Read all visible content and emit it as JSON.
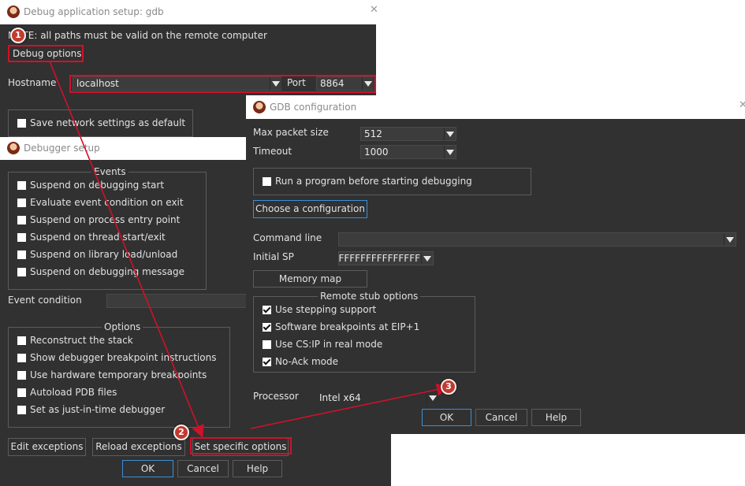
{
  "debug_app_dialog": {
    "title": "Debug application setup: gdb",
    "note": "NOTE: all paths must be valid on the remote computer",
    "debug_options_label": "Debug options",
    "hostname_label": "Hostname",
    "hostname_value": "localhost",
    "port_label": "Port",
    "port_value": "8864",
    "save_network_label": "Save network settings as default"
  },
  "debugger_setup": {
    "title": "Debugger setup",
    "events_title": "Events",
    "events": [
      {
        "label": "Suspend on debugging start",
        "checked": false
      },
      {
        "label": "Evaluate event condition on exit",
        "checked": false
      },
      {
        "label": "Suspend on process entry point",
        "checked": false
      },
      {
        "label": "Suspend on thread start/exit",
        "checked": false
      },
      {
        "label": "Suspend on library load/unload",
        "checked": false
      },
      {
        "label": "Suspend on debugging message",
        "checked": false
      }
    ],
    "event_condition_label": "Event condition",
    "options_title": "Options",
    "options": [
      {
        "label": "Reconstruct the stack",
        "checked": false
      },
      {
        "label": "Show debugger breakpoint instructions",
        "checked": false
      },
      {
        "label": "Use hardware temporary breakpoints",
        "checked": false
      },
      {
        "label": "Autoload PDB files",
        "checked": false
      },
      {
        "label": "Set as just-in-time debugger",
        "checked": false
      }
    ],
    "edit_exceptions_label": "Edit exceptions",
    "reload_exceptions_label": "Reload exceptions",
    "set_specific_label": "Set specific options",
    "ok_label": "OK",
    "cancel_label": "Cancel",
    "help_label": "Help"
  },
  "gdb_config": {
    "title": "GDB configuration",
    "max_packet_label": "Max packet size",
    "max_packet_value": "512",
    "timeout_label": "Timeout",
    "timeout_value": "1000",
    "run_program_label": "Run a program before starting debugging",
    "choose_config_label": "Choose a configuration",
    "command_line_label": "Command line",
    "command_line_value": "",
    "initial_sp_label": "Initial SP",
    "initial_sp_value": "FFFFFFFFFFFFFFFF",
    "memory_map_label": "Memory map",
    "remote_stub_title": "Remote stub options",
    "remote_stub": [
      {
        "label": "Use stepping support",
        "checked": true
      },
      {
        "label": "Software breakpoints at EIP+1",
        "checked": true
      },
      {
        "label": "Use CS:IP in real mode",
        "checked": false
      },
      {
        "label": "No-Ack mode",
        "checked": true
      }
    ],
    "processor_label": "Processor",
    "processor_value": "Intel x64",
    "ok_label": "OK",
    "cancel_label": "Cancel",
    "help_label": "Help"
  },
  "annotations": {
    "badge1": "1",
    "badge2": "2",
    "badge3": "3",
    "highlight_color": "#d0112b"
  },
  "icons": [
    "app-icon",
    "close-icon",
    "dropdown-arrow-icon",
    "checkbox-icon"
  ]
}
